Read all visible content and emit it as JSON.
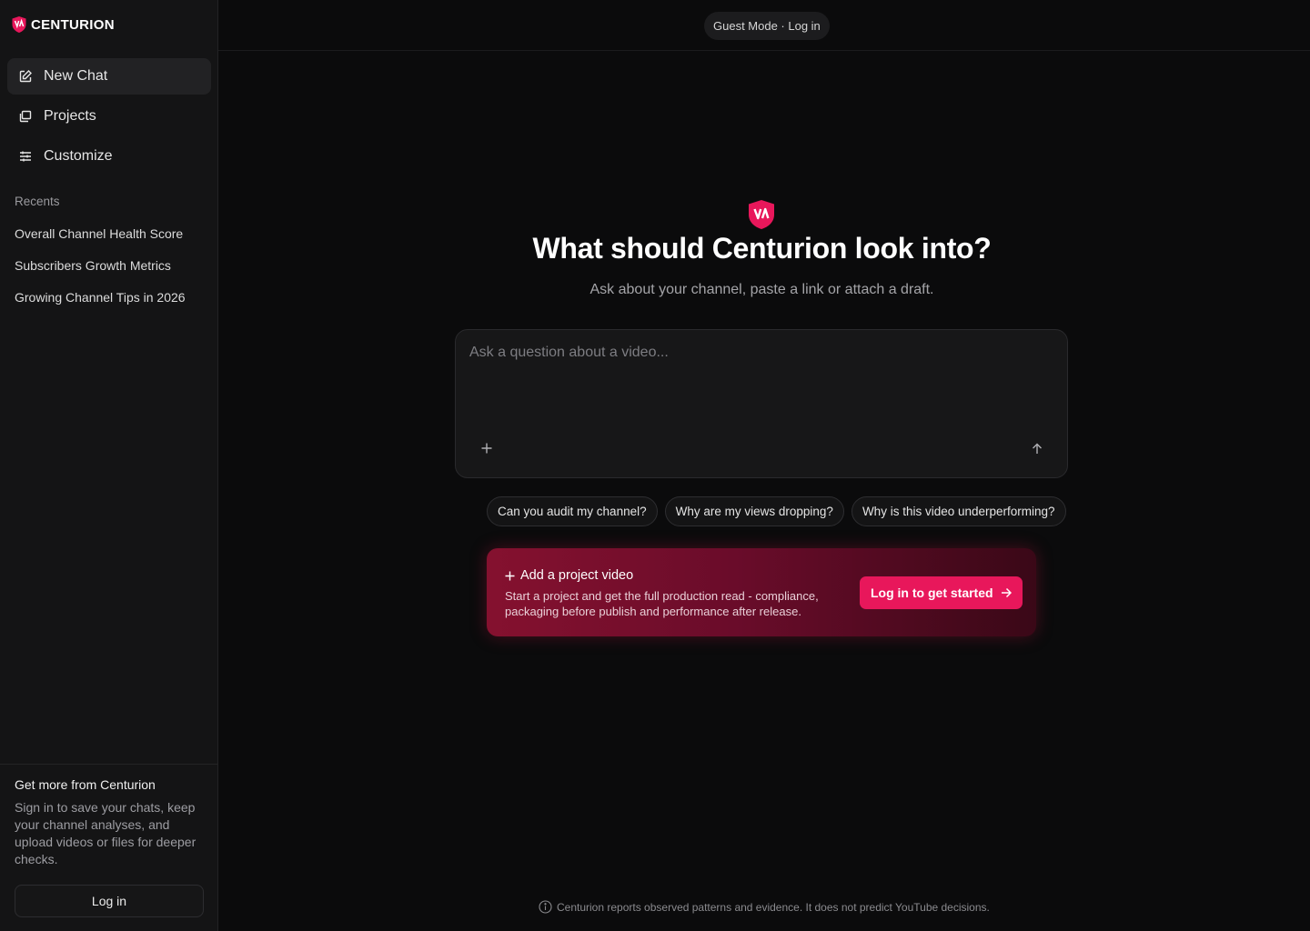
{
  "brand": {
    "name": "CENTURION",
    "accent": "#e8175b",
    "logo_text": "VA"
  },
  "nav": [
    {
      "label": "New Chat",
      "icon": "edit-icon",
      "active": true
    },
    {
      "label": "Projects",
      "icon": "projects-icon",
      "active": false
    },
    {
      "label": "Customize",
      "icon": "sliders-icon",
      "active": false
    }
  ],
  "recents": {
    "title": "Recents",
    "items": [
      "Overall Channel Health Score",
      "Subscribers Growth Metrics",
      "Growing Channel Tips in 2026"
    ]
  },
  "sidebar_footer": {
    "title": "Get more from Centurion",
    "text": "Sign in to save your chats, keep your channel analyses, and upload videos or files for deeper checks.",
    "login_label": "Log in"
  },
  "topbar": {
    "guest_label": "Guest Mode · Log in"
  },
  "hero": {
    "title": "What should Centurion look into?",
    "subtitle": "Ask about your channel, paste a link or attach a draft."
  },
  "composer": {
    "placeholder": "Ask a question about a video...",
    "value": ""
  },
  "suggestions": [
    "Can you audit my channel?",
    "Why are my views dropping?",
    "Why is this video underperforming?"
  ],
  "promo": {
    "title": "Add a project video",
    "text": "Start a project and get the full production read - compliance, packaging before publish and performance after release.",
    "button_label": "Log in to get started"
  },
  "disclaimer": "Centurion reports observed patterns and evidence. It does not predict YouTube decisions."
}
